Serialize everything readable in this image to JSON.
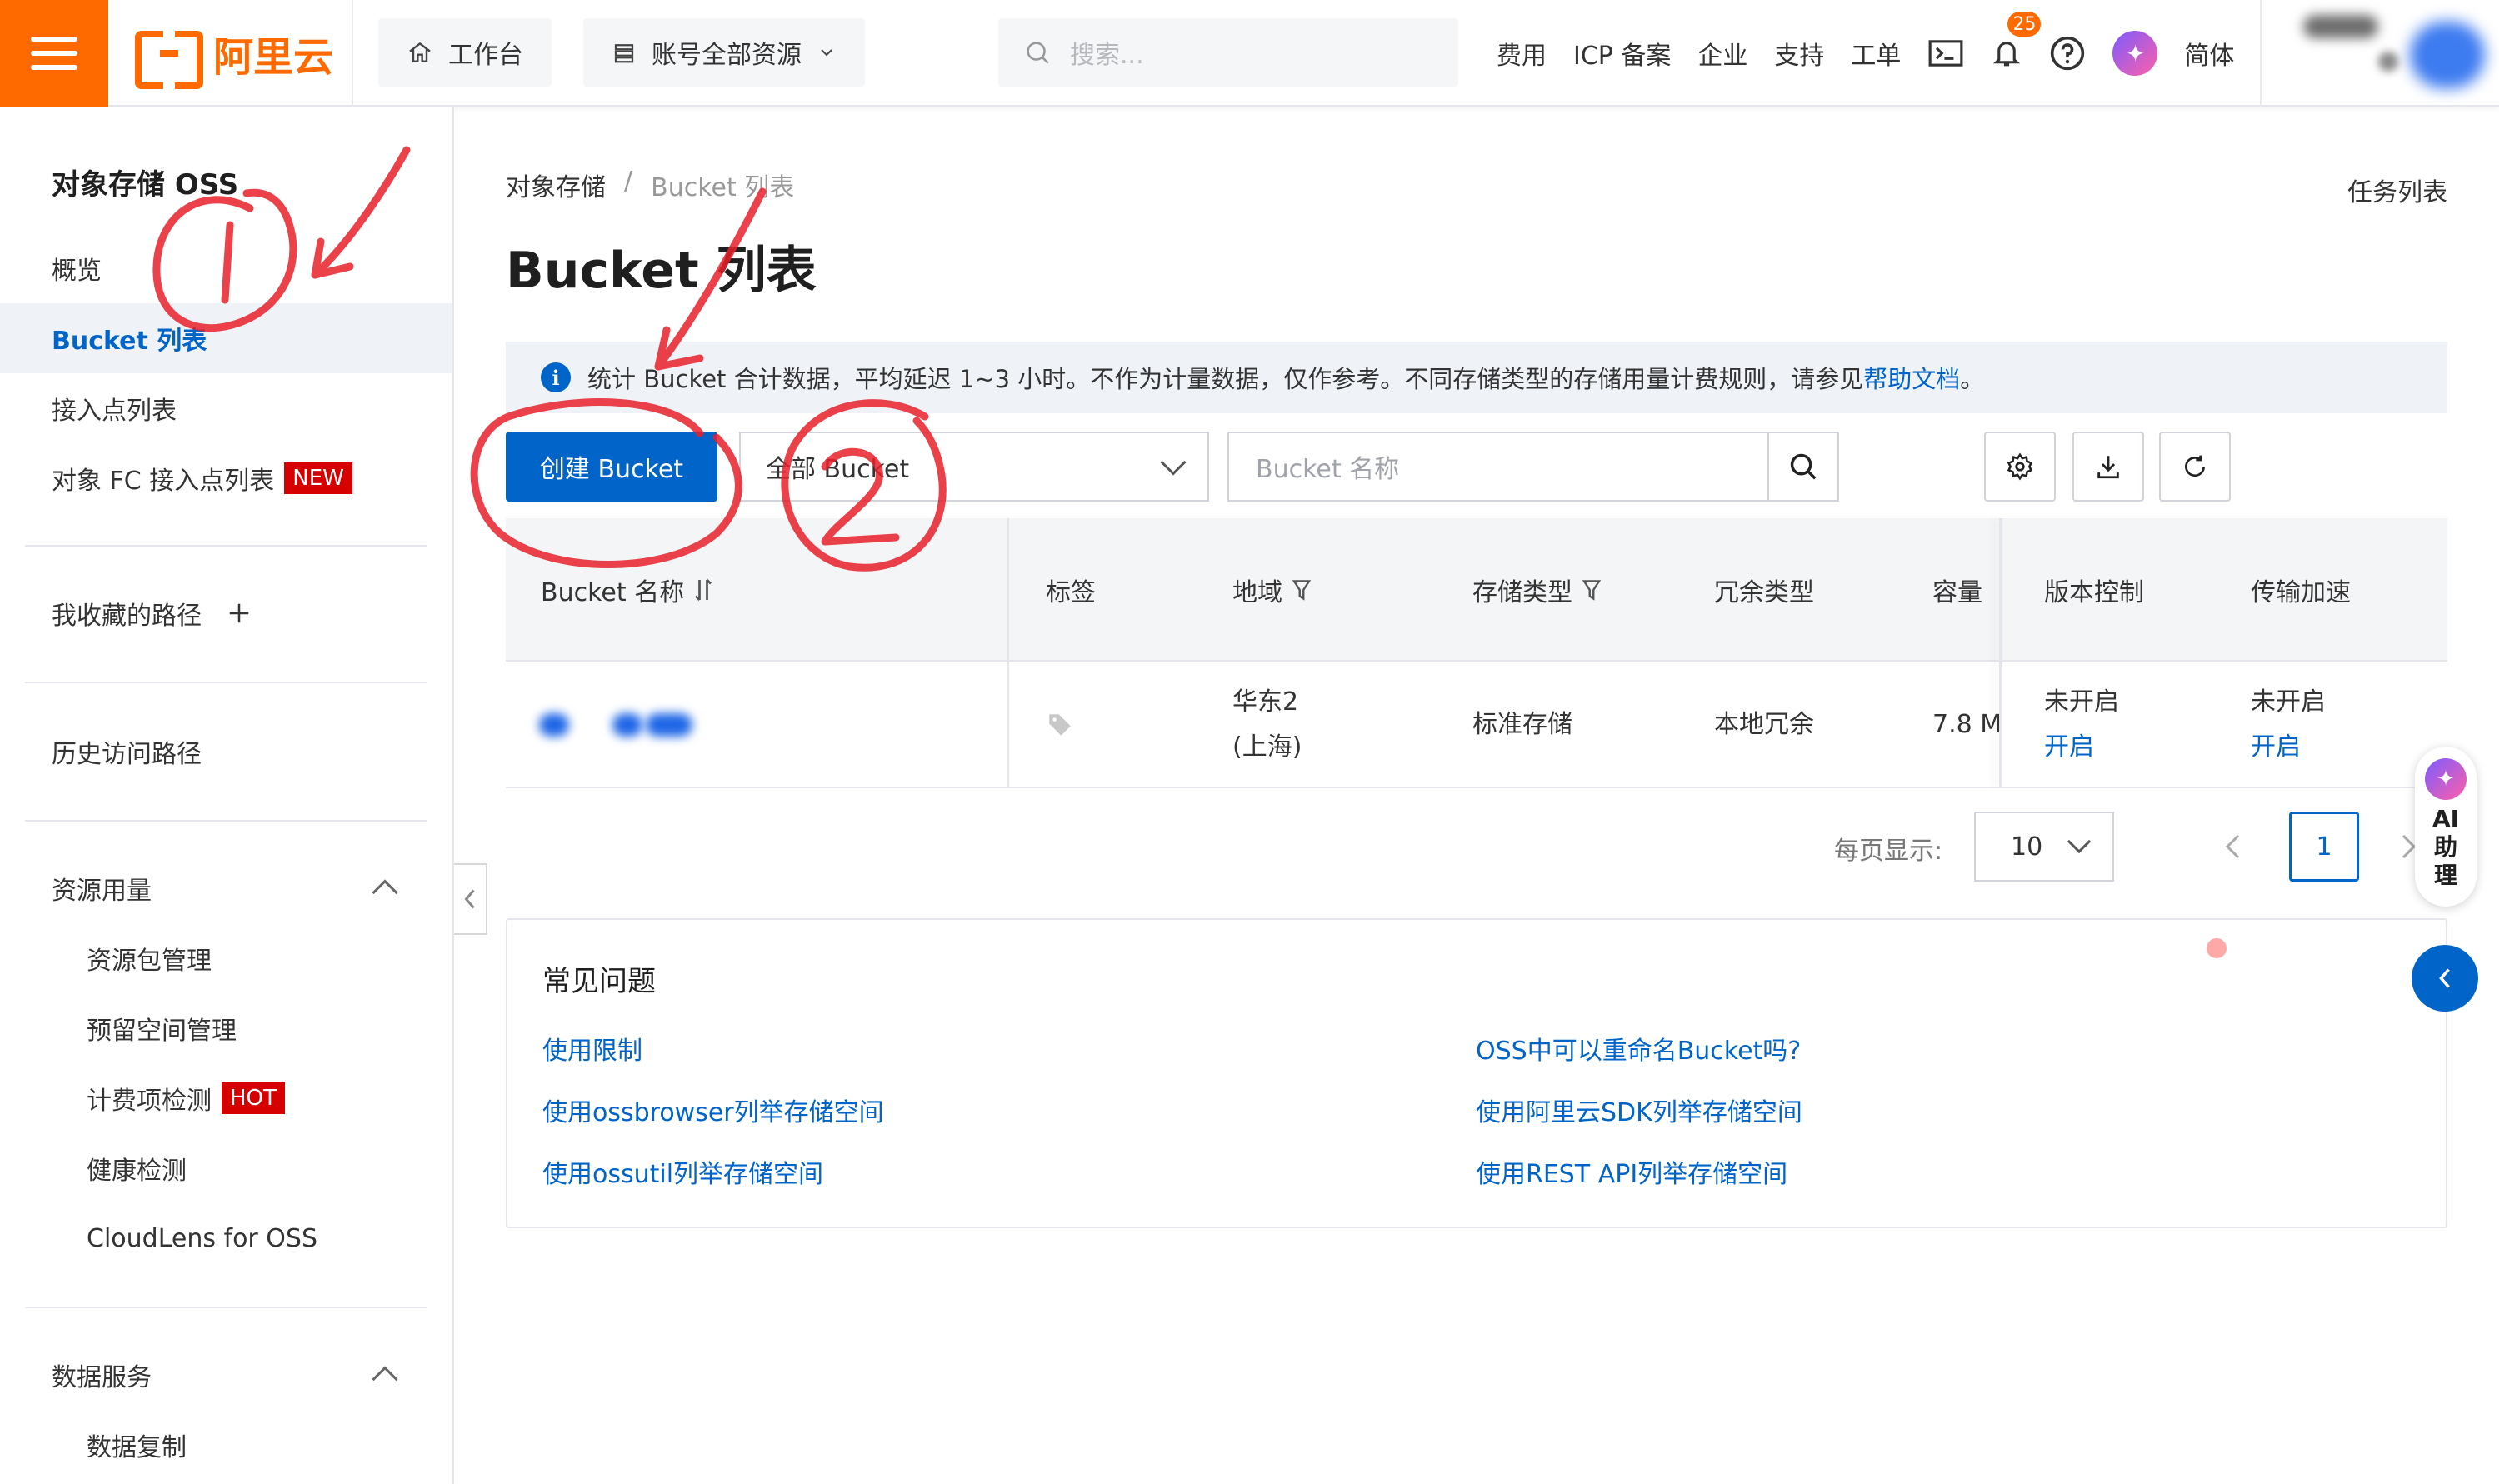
{
  "header": {
    "logo_text": "阿里云",
    "workbench": "工作台",
    "resources": "账号全部资源",
    "search_placeholder": "搜索...",
    "nav": [
      "费用",
      "ICP 备案",
      "企业",
      "支持",
      "工单"
    ],
    "notification_count": "25",
    "language": "简体"
  },
  "sidebar": {
    "title": "对象存储 OSS",
    "items": [
      {
        "label": "概览"
      },
      {
        "label": "Bucket 列表"
      },
      {
        "label": "接入点列表"
      },
      {
        "label": "对象 FC 接入点列表",
        "badge": "NEW"
      }
    ],
    "favorites": "我收藏的路径",
    "history": "历史访问路径",
    "resource_usage": {
      "label": "资源用量",
      "items": [
        {
          "label": "资源包管理"
        },
        {
          "label": "预留空间管理"
        },
        {
          "label": "计费项检测",
          "badge": "HOT"
        },
        {
          "label": "健康检测"
        },
        {
          "label": "CloudLens for OSS"
        }
      ]
    },
    "data_services": {
      "label": "数据服务",
      "items": [
        {
          "label": "数据复制"
        }
      ]
    }
  },
  "main": {
    "breadcrumb": [
      "对象存储",
      "/",
      "Bucket 列表"
    ],
    "task_list": "任务列表",
    "page_title": "Bucket 列表",
    "info_text": "统计 Bucket 合计数据，平均延迟 1~3 小时。不作为计量数据，仅作参考。不同存储类型的存储用量计费规则，请参见",
    "info_link": "帮助文档",
    "info_end": "。",
    "create_button": "创建 Bucket",
    "filter_select": "全部 Bucket",
    "name_placeholder": "Bucket 名称",
    "table": {
      "headers": [
        "Bucket 名称",
        "标签",
        "地域",
        "存储类型",
        "冗余类型",
        "容量",
        "版本控制",
        "传输加速"
      ],
      "row": {
        "region_line1": "华东2",
        "region_line2": "(上海)",
        "storage_type": "标准存储",
        "redundancy": "本地冗余",
        "capacity": "7.8 M",
        "versioning": "未开启",
        "versioning_action": "开启",
        "acceleration": "未开启",
        "acceleration_action": "开启"
      }
    },
    "pagination": {
      "per_page_label": "每页显示:",
      "per_page": "10",
      "current_page": "1"
    },
    "faq": {
      "title": "常见问题",
      "links": [
        "使用限制",
        "OSS中可以重命名Bucket吗?",
        "使用ossbrowser列举存储空间",
        "使用阿里云SDK列举存储空间",
        "使用ossutil列举存储空间",
        "使用REST API列举存储空间"
      ]
    }
  },
  "ai_assistant": {
    "label": "AI助理"
  },
  "colors": {
    "brand": "#ff6a00",
    "primary": "#0064c8",
    "annotation": "#e8202a"
  }
}
